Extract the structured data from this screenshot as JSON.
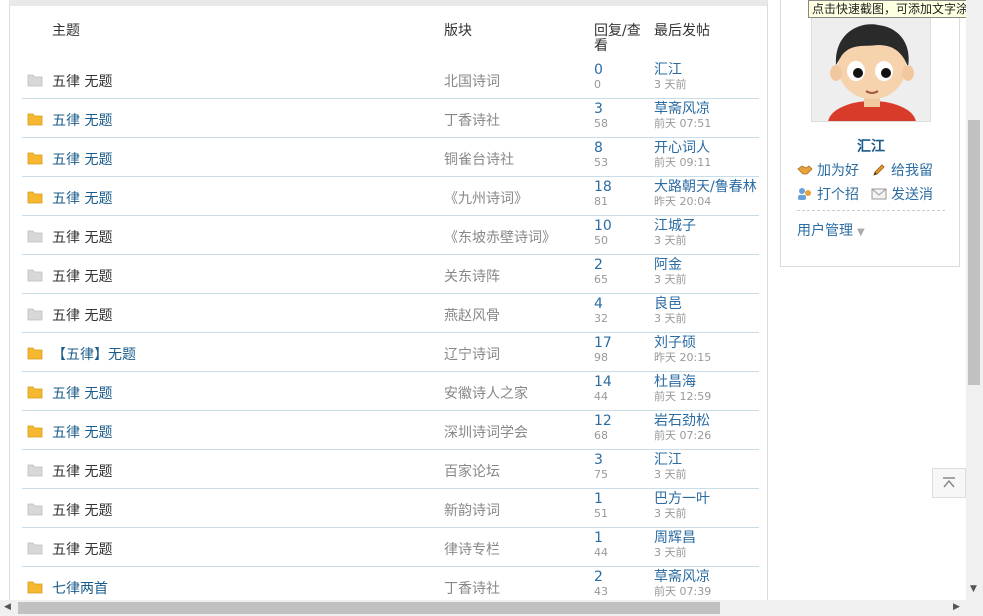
{
  "table": {
    "headers": {
      "subject": "主题",
      "board": "版块",
      "replies_views": "回复/查看",
      "last_post": "最后发帖"
    },
    "rows": [
      {
        "icon": "folder-gray-icon",
        "subject": "五律 无题",
        "board": "北国诗词",
        "replies": "0",
        "views": "0",
        "last_user": "汇江",
        "last_time": "3 天前"
      },
      {
        "icon": "folder-orange-icon",
        "subject": "五律 无题",
        "board": "丁香诗社",
        "replies": "3",
        "views": "58",
        "last_user": "草斋风凉",
        "last_time": "前天 07:51"
      },
      {
        "icon": "folder-orange-icon",
        "subject": "五律 无题",
        "board": "铜雀台诗社",
        "replies": "8",
        "views": "53",
        "last_user": "开心词人",
        "last_time": "前天 09:11"
      },
      {
        "icon": "folder-orange-icon",
        "subject": "五律 无题",
        "board": "《九州诗词》",
        "replies": "18",
        "views": "81",
        "last_user": "大路朝天/鲁春林",
        "last_time": "昨天 20:04"
      },
      {
        "icon": "folder-gray-icon",
        "subject": "五律 无题",
        "board": "《东坡赤壁诗词》",
        "replies": "10",
        "views": "50",
        "last_user": "江城子",
        "last_time": "3 天前"
      },
      {
        "icon": "folder-gray-icon",
        "subject": "五律 无题",
        "board": "关东诗阵",
        "replies": "2",
        "views": "65",
        "last_user": "阿金",
        "last_time": "3 天前"
      },
      {
        "icon": "folder-gray-icon",
        "subject": "五律 无题",
        "board": "燕赵风骨",
        "replies": "4",
        "views": "32",
        "last_user": "良邑",
        "last_time": "3 天前"
      },
      {
        "icon": "folder-orange-icon",
        "subject": "【五律】无题",
        "board": "辽宁诗词",
        "replies": "17",
        "views": "98",
        "last_user": "刘子硕",
        "last_time": "昨天 20:15"
      },
      {
        "icon": "folder-orange-icon",
        "subject": "五律 无题",
        "board": "安徽诗人之家",
        "replies": "14",
        "views": "44",
        "last_user": "杜昌海",
        "last_time": "前天 12:59"
      },
      {
        "icon": "folder-orange-icon",
        "subject": "五律 无题",
        "board": "深圳诗词学会",
        "replies": "12",
        "views": "68",
        "last_user": "岩石劲松",
        "last_time": "前天 07:26"
      },
      {
        "icon": "folder-gray-icon",
        "subject": "五律 无题",
        "board": "百家论坛",
        "replies": "3",
        "views": "75",
        "last_user": "汇江",
        "last_time": "3 天前"
      },
      {
        "icon": "folder-gray-icon",
        "subject": "五律 无题",
        "board": "新韵诗词",
        "replies": "1",
        "views": "51",
        "last_user": "巴方一叶",
        "last_time": "3 天前"
      },
      {
        "icon": "folder-gray-icon",
        "subject": "五律 无题",
        "board": "律诗专栏",
        "replies": "1",
        "views": "44",
        "last_user": "周辉昌",
        "last_time": "3 天前"
      },
      {
        "icon": "folder-orange-icon",
        "subject": "七律两首",
        "board": "丁香诗社",
        "replies": "2",
        "views": "43",
        "last_user": "草斋风凉",
        "last_time": "前天 07:39"
      }
    ]
  },
  "user_card": {
    "username": "汇江",
    "actions": {
      "add_friend": "加为好",
      "leave_message": "给我留",
      "greet": "打个招",
      "send_message": "发送消"
    },
    "user_management": "用户管理"
  },
  "tooltip": {
    "text": "点击快速截图，可添加文字涂鸦"
  },
  "colors": {
    "link": "#2b6ca3",
    "folder_orange": "#f5b830",
    "folder_gray": "#d8d8d8",
    "row_border": "#c9dde8"
  }
}
